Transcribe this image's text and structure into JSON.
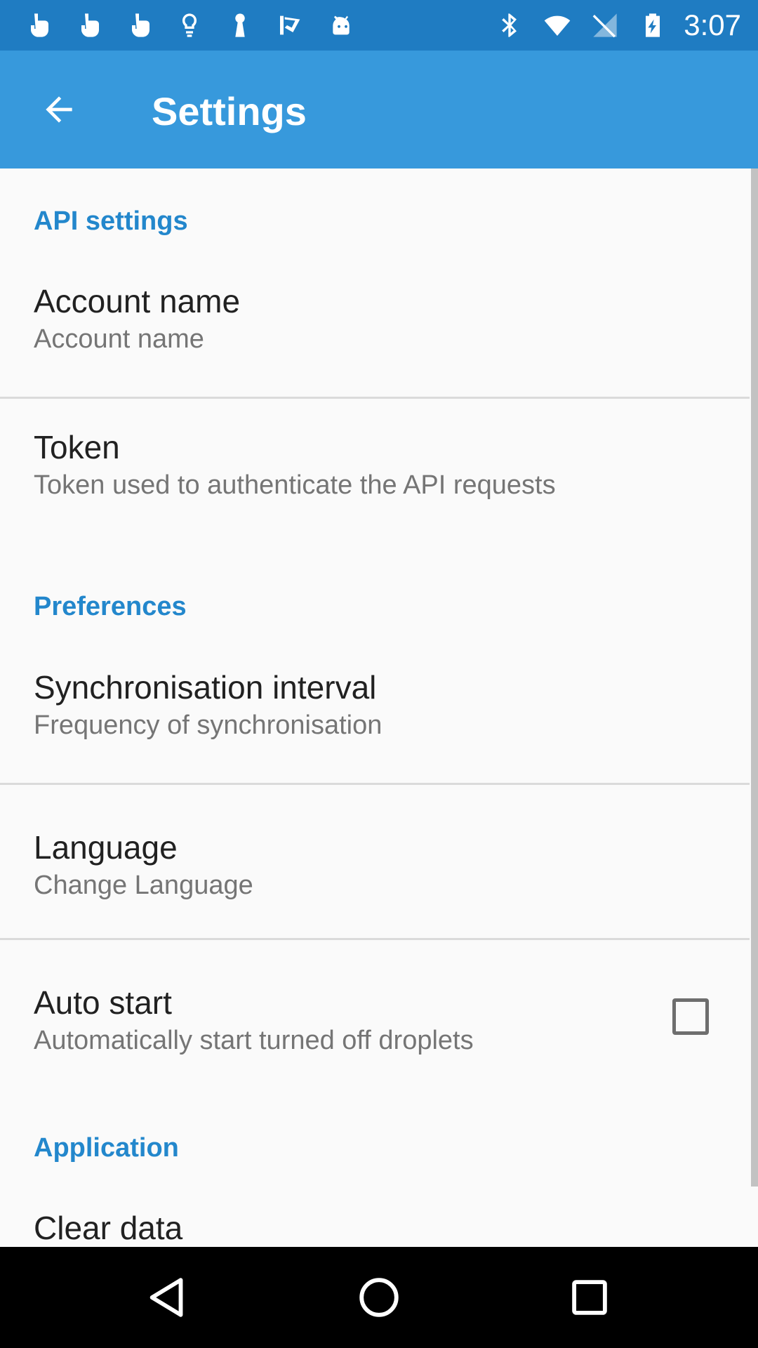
{
  "status_bar": {
    "left_icons": [
      "hand-pointer-icon",
      "hand-pointer-icon",
      "hand-pointer-icon",
      "lightbulb-icon",
      "keyhole-icon",
      "check-flag-icon",
      "android-icon"
    ],
    "right_icons": [
      "bluetooth-icon",
      "wifi-icon",
      "no-signal-icon",
      "battery-charging-icon"
    ],
    "time": "3:07"
  },
  "app_bar": {
    "back_icon": "arrow-back-icon",
    "title": "Settings",
    "color": "#3799dc"
  },
  "sections": [
    {
      "header": "API settings",
      "items": [
        {
          "title": "Account name",
          "summary": "Account name"
        },
        {
          "title": "Token",
          "summary": "Token used to authenticate the API requests"
        }
      ]
    },
    {
      "header": "Preferences",
      "items": [
        {
          "title": "Synchronisation interval",
          "summary": "Frequency of synchronisation"
        },
        {
          "title": "Language",
          "summary": "Change Language"
        },
        {
          "title": "Auto start",
          "summary": "Automatically start turned off droplets",
          "checked": false
        }
      ]
    },
    {
      "header": "Application",
      "items": [
        {
          "title": "Clear data"
        }
      ]
    }
  ],
  "nav_bar": {
    "buttons": [
      "back-triangle-icon",
      "home-circle-icon",
      "recents-square-icon"
    ]
  },
  "colors": {
    "status_bar": "#1f7cc2",
    "accent": "#2387cc"
  }
}
